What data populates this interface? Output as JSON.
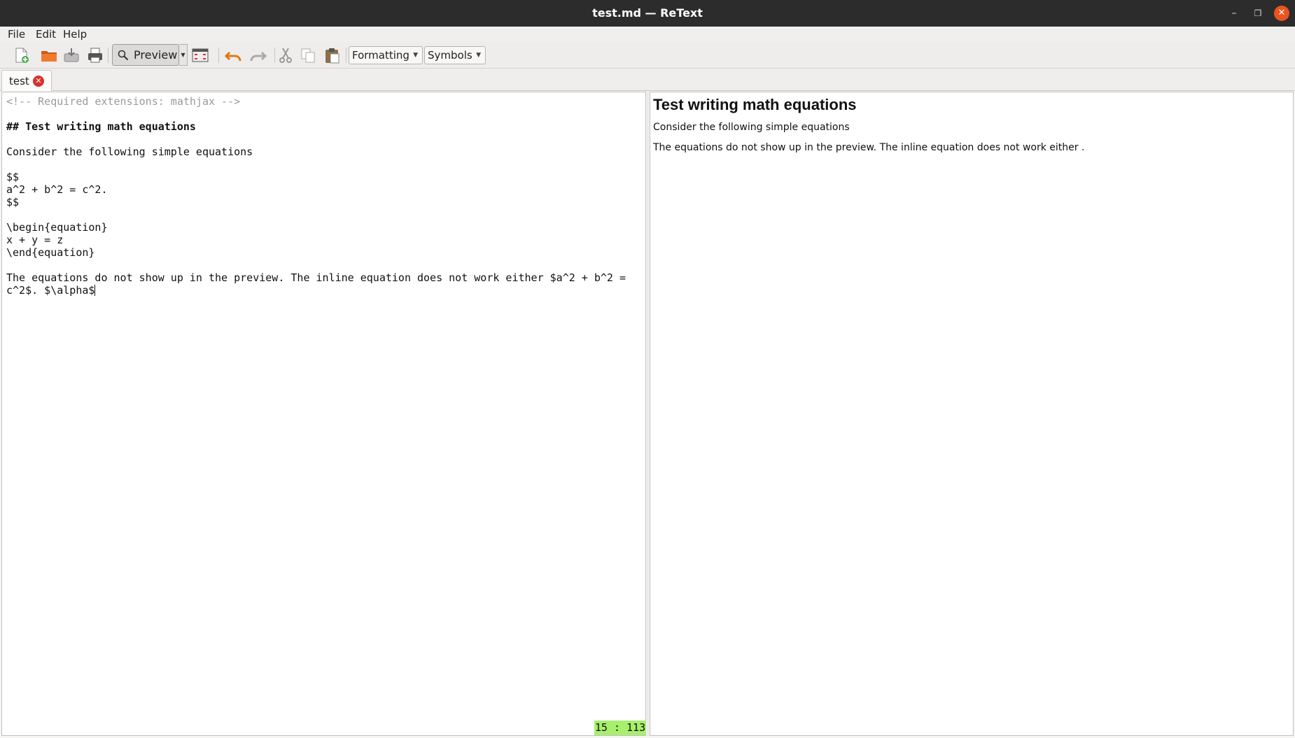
{
  "window": {
    "title": "test.md — ReText"
  },
  "menu": {
    "file": "File",
    "edit": "Edit",
    "help": "Help"
  },
  "toolbar": {
    "preview_label": "Preview",
    "formatting_label": "Formatting",
    "symbols_label": "Symbols"
  },
  "tabs": [
    {
      "label": "test"
    }
  ],
  "editor": {
    "lines": [
      "<!-- Required extensions: mathjax -->",
      "",
      "## Test writing math equations",
      "",
      "Consider the following simple equations",
      "",
      "$$",
      "a^2 + b^2 = c^2.",
      "$$",
      "",
      "\\begin{equation}",
      "x + y = z",
      "\\end{equation}",
      "",
      "The equations do not show up in the preview. The inline equation does not work either $a^2 + b^2 =",
      "c^2$. $\\alpha$"
    ],
    "cursor_position": "15 : 113"
  },
  "preview": {
    "heading": "Test writing math equations",
    "para1": "Consider the following simple equations",
    "para2": "The equations do not show up in the preview. The inline equation does not work either ."
  },
  "colors": {
    "titlebar": "#2c2c2c",
    "close_button": "#e95420",
    "status_highlight": "#a8ef6e",
    "tab_close": "#d8312e"
  }
}
